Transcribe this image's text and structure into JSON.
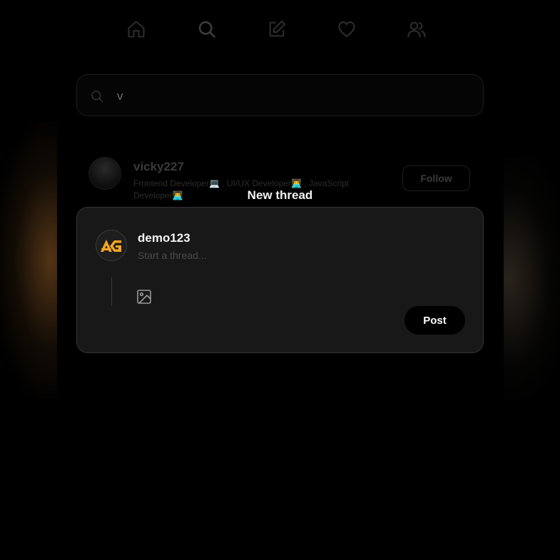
{
  "nav": {
    "icons": [
      "home-icon",
      "search-icon",
      "edit-icon",
      "heart-icon",
      "users-icon"
    ]
  },
  "search": {
    "value": "v",
    "placeholder": "Search"
  },
  "result": {
    "username": "vicky227",
    "bio": "Frontend Developer💻 , UI/UX Developer👨‍💻 , JavaScript Developer👨‍💻",
    "follow_label": "Follow"
  },
  "modal": {
    "title": "New thread",
    "username": "demo123",
    "placeholder": "Start a thread...",
    "post_label": "Post"
  },
  "colors": {
    "background": "#000000",
    "modal_bg": "#181818",
    "brand_orange": "#f5a623"
  }
}
